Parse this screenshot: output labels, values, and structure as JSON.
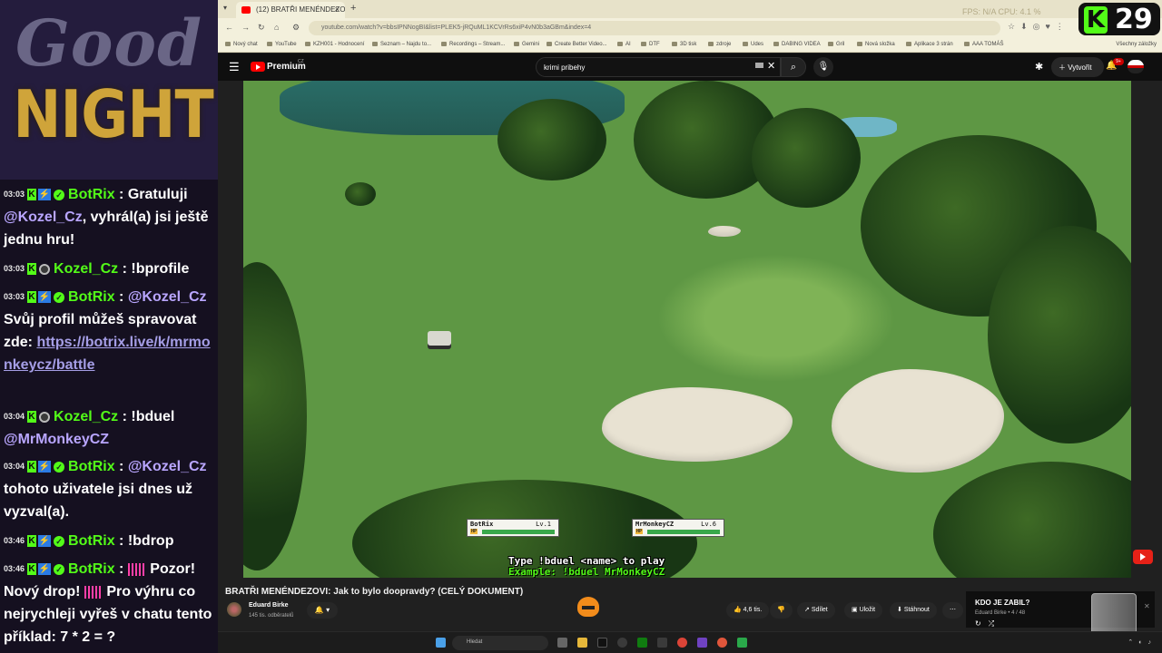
{
  "overlay": {
    "logo_line1": "Good",
    "logo_line2": "NIGHT",
    "kick_count": "29",
    "kick_letter": "K"
  },
  "chat": [
    {
      "time": "03:03",
      "user": "BotRix",
      "bot": true,
      "text_pre": "Gratuluji ",
      "mention": "@Kozel_Cz",
      "text_post": ", vyhrál(a) jsi ještě jednu hru!"
    },
    {
      "time": "03:03",
      "user": "Kozel_Cz",
      "bot": false,
      "text": "!bprofile"
    },
    {
      "time": "03:03",
      "user": "BotRix",
      "bot": true,
      "mention": "@Kozel_Cz",
      "text_post": " Svůj profil můžeš spravovat zde: ",
      "link": "https://botrix.live/k/mrmonkeycz/battle"
    },
    {
      "time": "03:04",
      "user": "Kozel_Cz",
      "bot": false,
      "text": "!bduel ",
      "mention": "@MrMonkeyCZ"
    },
    {
      "time": "03:04",
      "user": "BotRix",
      "bot": true,
      "mention": "@Kozel_Cz",
      "text_post": " tohoto uživatele jsi dnes už vyzval(a)."
    },
    {
      "time": "03:46",
      "user": "BotRix",
      "bot": true,
      "text": "!bdrop"
    },
    {
      "time": "03:46",
      "user": "BotRix",
      "bot": true,
      "text_a": "Pozor! Nový drop!",
      "text_b": "Pro výhru co nejrychleji vyřeš v chatu tento příklad: 7 * 2 = ?"
    }
  ],
  "browser": {
    "tab_title": "(12) BRATŘI MENÉNDEZO...",
    "address": "youtube.com/watch?v=bbsIPNNogBI&list=PLEK5-jRQuML1KCVrRs6xiP4vN0b3aGBm&index=4",
    "title_right": "FPS: N/A   CPU: 4.1 %",
    "bookmarks": [
      "Nový chat",
      "YouTube",
      "KZH001 - Hodnocení",
      "Seznam – Najdu to...",
      "Recordings – Stream...",
      "Gemini",
      "Create Better Video...",
      "AI",
      "DTF",
      "3D tisk",
      "zdroje",
      "Udes",
      "DABING VIDEA",
      "Gril",
      "Nová složka",
      "Aplikace 3 strán",
      "AAA TOMÁŠ"
    ],
    "bookmarks_right": "Všechny záložky"
  },
  "youtube": {
    "premium_label": "Premium",
    "premium_cc": "CZ",
    "search_value": "krimi pribehy",
    "create_label": "Vytvořit",
    "notif_count": "9+",
    "video_title": "BRATŘI MENÉNDEZOVI: Jak to bylo doopravdy? (CELÝ DOKUMENT)",
    "channel_name": "Eduard Birke",
    "channel_subs": "145 tis. odběratelů",
    "likes": "4,6 tis.",
    "share": "Sdílet",
    "save": "Uložit",
    "download": "Stáhnout",
    "next_title": "KDO JE ZABIL?",
    "next_sub": "Eduard Birke • 4 / 48"
  },
  "duel": {
    "player1": {
      "name": "BotRix",
      "level": "Lv.1",
      "hp": 1.0
    },
    "player2": {
      "name": "MrMonkeyCZ",
      "level": "Lv.6",
      "hp": 1.0
    },
    "hp_label": "HP",
    "line1": "Type !bduel <name> to play",
    "line2": "Example: !bduel MrMonkeyCZ"
  },
  "taskbar": {
    "search_placeholder": "Hledat"
  },
  "colors": {
    "kick_green": "#53fc18",
    "youtube_red": "#ff0000",
    "chat_bg": "#151020",
    "logo_gold": "#cfa43a"
  }
}
